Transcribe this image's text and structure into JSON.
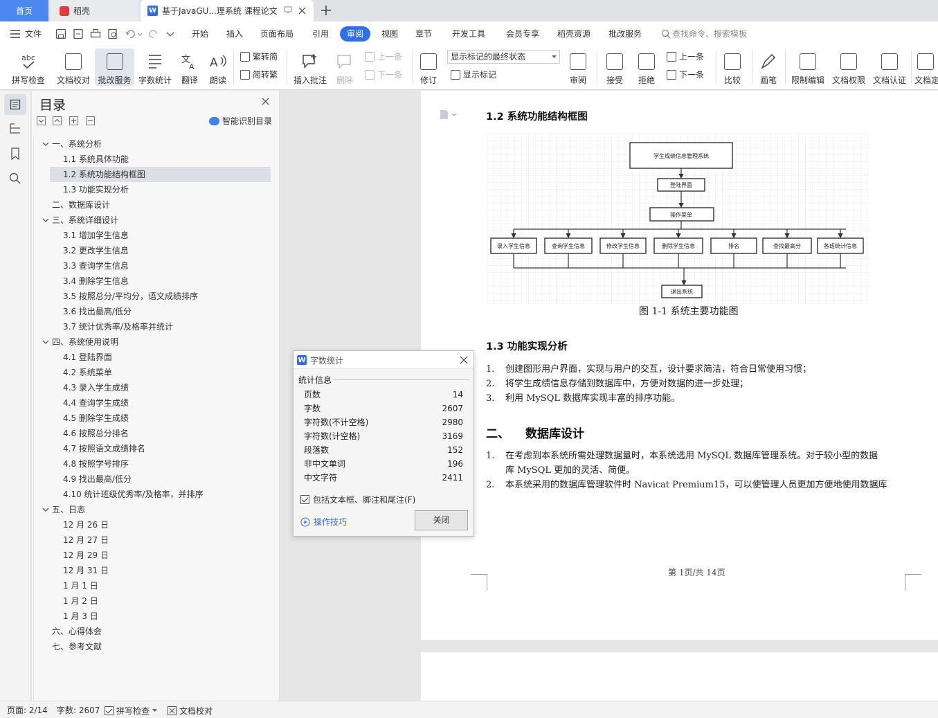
{
  "tabs": {
    "home": "首页",
    "daoke": "稻壳",
    "doc": "基于JavaGU...理系统 课程论文"
  },
  "menu": {
    "file": "文件",
    "items": [
      "开始",
      "插入",
      "页面布局",
      "引用",
      "审阅",
      "视图",
      "章节",
      "开发工具",
      "会员专享",
      "稻壳资源",
      "批改服务"
    ],
    "active": "审阅",
    "search_placeholder": "查找命令、搜索模板"
  },
  "ribbon": {
    "spellcheck": "拼写检查",
    "doc_check": "文档校对",
    "correction": "批改服务",
    "word_count": "字数统计",
    "translate": "翻译",
    "read_aloud": "朗读",
    "trad_to_simp": "繁转简",
    "simp_to_trad": "简转繁",
    "insert_comment": "插入批注",
    "delete": "删除",
    "prev": "上一条",
    "next": "下一条",
    "track": "修订",
    "markup_state": "显示标记的最终状态",
    "show_markup": "显示标记",
    "review": "审阅",
    "accept": "接受",
    "reject": "拒绝",
    "prev2": "上一条",
    "next2": "下一条",
    "compare": "比较",
    "pen": "画笔",
    "restrict": "限制编辑",
    "permission": "文档权限",
    "certify": "文档认证",
    "finalize": "文档定"
  },
  "nav": {
    "title": "目录",
    "smart": "智能识别目录",
    "items": [
      "一、系统分析",
      "1.1  系统具体功能",
      "1.2  系统功能结构框图",
      "1.3  功能实现分析",
      "二、数据库设计",
      "三、系统详细设计",
      "3.1  增加学生信息",
      "3.2  更改学生信息",
      "3.3  查询学生信息",
      "3.4  删除学生信息",
      "3.5  按照总分/平均分，语文成绩排序",
      "3.6  找出最高/低分",
      "3.7  统计优秀率/及格率并统计",
      "四、系统使用说明",
      "4.1  登陆界面",
      "4.2  系统菜单",
      "4.3  录入学生成绩",
      "4.4 查询学生成绩",
      "4.5  删除学生成绩",
      "4.6  按照总分排名",
      "4.7  按照语文成绩排名",
      "4.8  按照学号排序",
      "4.9  找出最高/低分",
      "4.10  统计班级优秀率/及格率，并排序",
      "五、日志",
      "12 月 26 日",
      "12 月 27  日",
      "12 月 29 日",
      "12 月 31 日",
      "1 月 1 日",
      "1 月 2 日",
      "1 月 3 日",
      "六、心得体会",
      "七、参考文献"
    ]
  },
  "doc": {
    "h_12": "1.2  系统功能结构框图",
    "diagram": {
      "root": "学生成绩信息管理系统",
      "login": "登陆界面",
      "menu": "操作菜单",
      "children": [
        "录入学生信息",
        "查询学生信息",
        "修改学生信息",
        "删除学生信息",
        "排名",
        "查找最高分",
        "各班统计信息"
      ],
      "exit": "退出系统"
    },
    "caption": "图 1-1  系统主要功能图",
    "h_13": "1.3  功能实现分析",
    "list1": [
      {
        "n": "1.",
        "t": "创建图形用户界面，实现与用户的交互，设计要求简洁，符合日常使用习惯；"
      },
      {
        "n": "2.",
        "t": "将学生成绩信息存储到数据库中，方便对数据的进一步处理；"
      },
      {
        "n": "3.",
        "t": "利用 MySQL 数据库实现丰富的排序功能。"
      }
    ],
    "h_2_num": "二、",
    "h_2": "数据库设计",
    "list2_1a": "在考虑到本系统所需处理数据量时，本系统选用 MySQL 数据库管理系统。对于较小型的数据",
    "list2_1b": "库 MySQL 更加的灵活、简便。",
    "list2_2": "本系统采用的数据库管理软件时 Navicat Premium15，可以使管理人员更加方便地使用数据库",
    "list2_n1": "1.",
    "list2_n2": "2.",
    "footer": "第 1页/共 14页"
  },
  "dialog": {
    "title": "字数统计",
    "section": "统计信息",
    "rows": [
      {
        "label": "页数",
        "value": "14"
      },
      {
        "label": "字数",
        "value": "2607"
      },
      {
        "label": "字符数(不计空格)",
        "value": "2980"
      },
      {
        "label": "字符数(计空格)",
        "value": "3169"
      },
      {
        "label": "段落数",
        "value": "152"
      },
      {
        "label": "非中文单词",
        "value": "196"
      },
      {
        "label": "中文字符",
        "value": "2411"
      }
    ],
    "include": "包括文本框、脚注和尾注(F)",
    "tips": "操作技巧",
    "close": "关闭"
  },
  "status": {
    "page": "页面: 2/14",
    "words": "字数: 2607",
    "spell": "拼写检查",
    "proof": "文档校对"
  },
  "colors": {
    "accent": "#2f6fe8",
    "home_tab": "#4a87f0"
  }
}
